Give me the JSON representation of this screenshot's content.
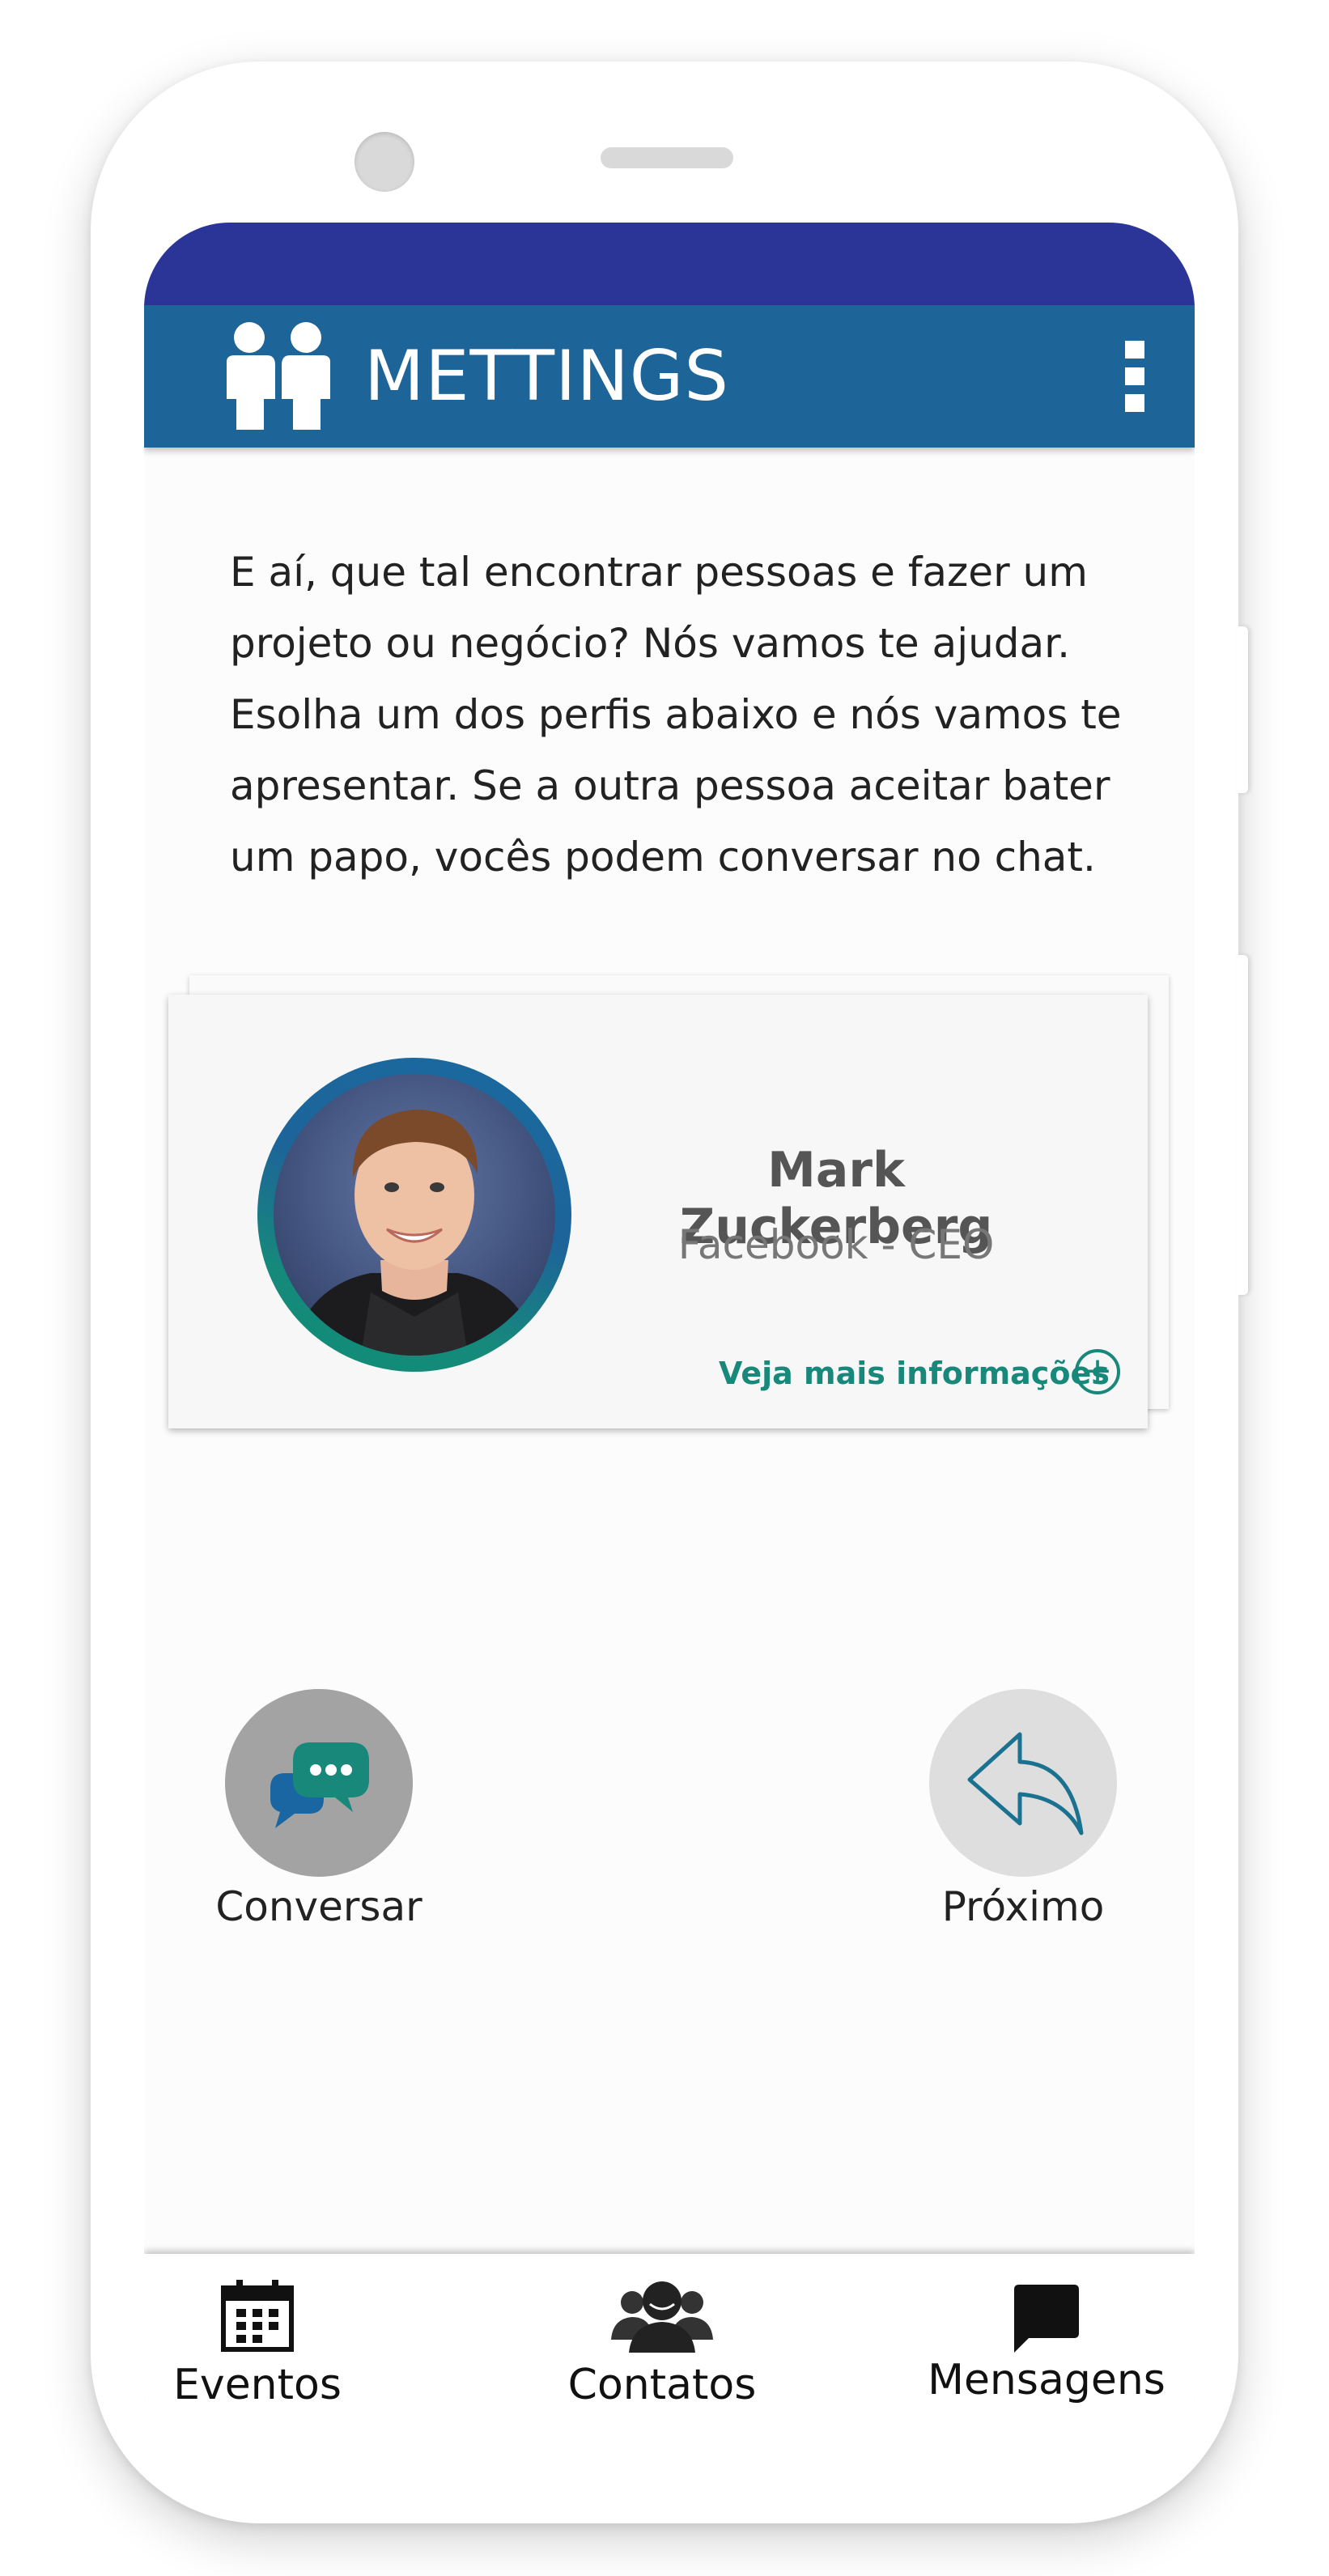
{
  "app": {
    "title": "METTINGS",
    "logo_icon": "people-pair-icon",
    "menu_icon": "vertical-dots-icon"
  },
  "intro": {
    "text": "E aí, que tal encontrar pessoas e fazer um projeto ou negócio? Nós vamos te ajudar. Esolha um dos perfis abaixo e nós vamos te apresentar. Se a outra pessoa aceitar bater um papo, vocês podem conversar no chat."
  },
  "profile_card": {
    "name": "Mark Zuckerberg",
    "role": "Facebook - CEO",
    "more_info_label": "Veja mais informações",
    "more_info_icon": "plus-circle-icon"
  },
  "actions": {
    "chat_label": "Conversar",
    "next_label": "Próximo"
  },
  "bottom_nav": {
    "items": [
      {
        "label": "Eventos",
        "icon": "calendar-icon"
      },
      {
        "label": "Contatos",
        "icon": "contacts-icon"
      },
      {
        "label": "Mensagens",
        "icon": "message-icon"
      }
    ]
  },
  "colors": {
    "status_bar": "#2b3597",
    "app_bar": "#1d6499",
    "accent_green": "#17887a"
  }
}
